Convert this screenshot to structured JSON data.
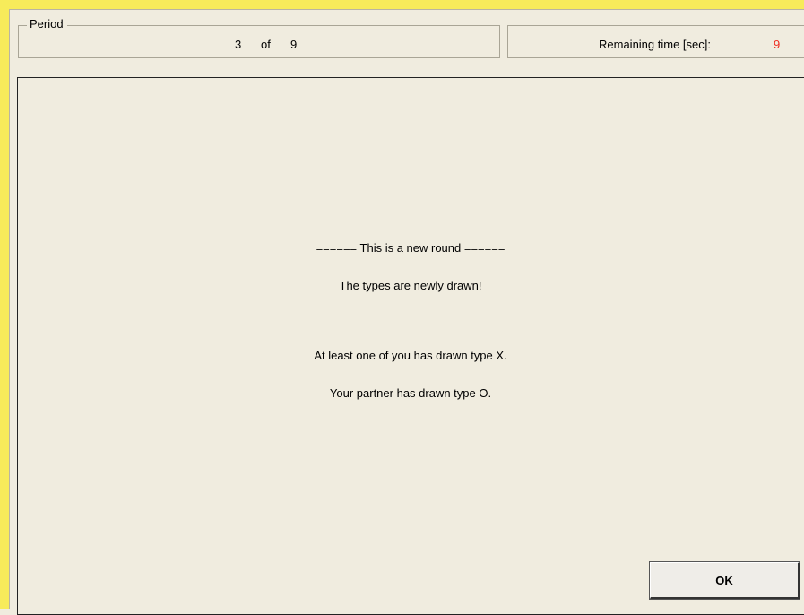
{
  "header": {
    "period_label": "Period",
    "period_current": "3",
    "period_of": "of",
    "period_total": "9",
    "remaining_label": "Remaining time [sec]:",
    "remaining_value": "9"
  },
  "messages": [
    "====== This is a new round ======",
    "The types are newly drawn!",
    "At least one of you has drawn type X.",
    "Your partner has drawn type O."
  ],
  "buttons": {
    "ok_label": "OK"
  },
  "colors": {
    "frame_yellow": "#f7eb5a",
    "panel_background": "#f0ecdf",
    "timer_value": "#ee2a1f"
  }
}
